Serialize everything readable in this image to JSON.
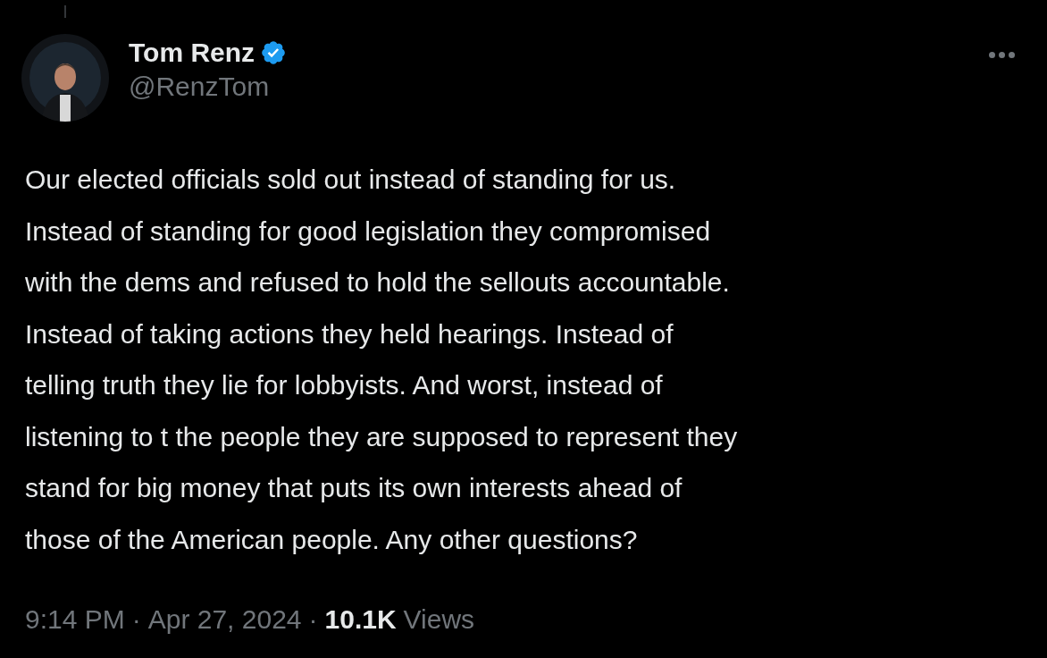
{
  "author": {
    "name": "Tom Renz",
    "verified": true,
    "handle": "@RenzTom"
  },
  "tweet": {
    "lines": [
      "Our elected officials sold out instead of standing for us.",
      "Instead of standing for good legislation they compromised",
      "with the dems and refused to hold the sellouts accountable.",
      "Instead of taking actions they held hearings. Instead of",
      "telling truth they lie for lobbyists. And worst, instead of",
      "listening to t the people they are supposed to represent they",
      "stand for big money that puts its own interests ahead of",
      "those of the American people. Any other questions?"
    ]
  },
  "meta": {
    "time": "9:14 PM",
    "separator": "·",
    "date": "Apr 27, 2024",
    "views_count": "10.1K",
    "views_label": "Views"
  }
}
